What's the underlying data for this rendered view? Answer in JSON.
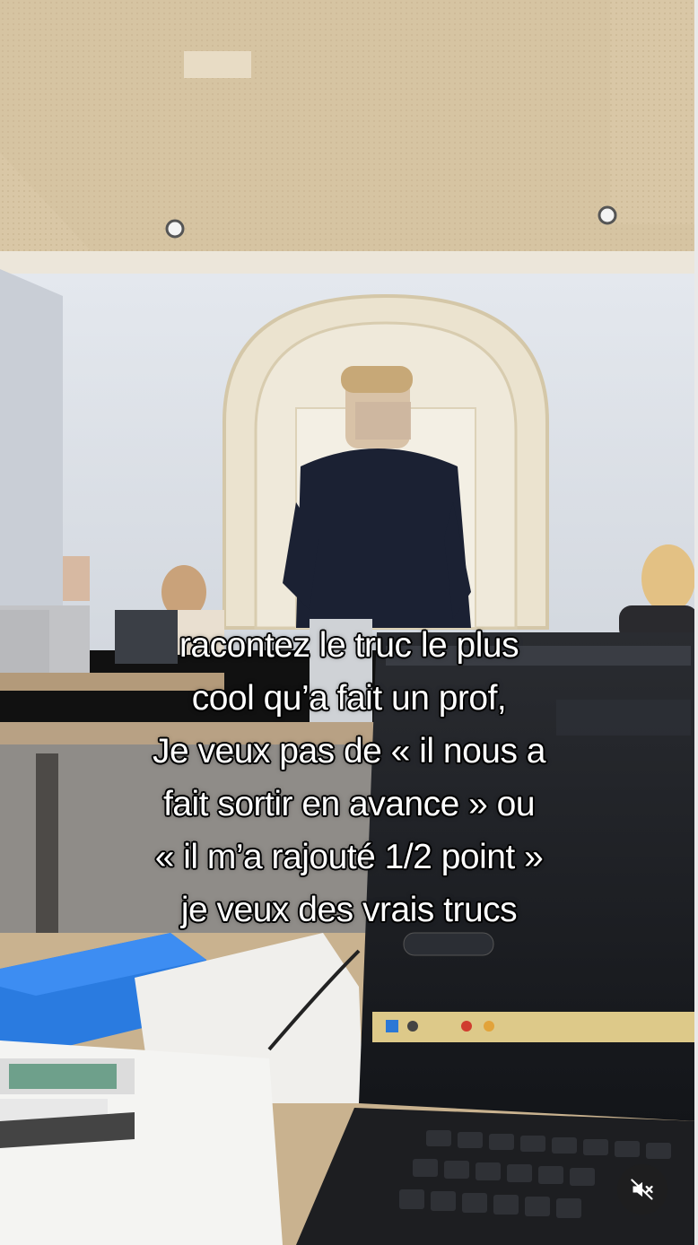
{
  "caption": {
    "lines": [
      "racontez le truc le plus",
      "cool qu’a fait un prof,",
      "Je veux pas de « il nous a",
      "fait sortir en avance » ou",
      "« il m’a rajouté 1/2 point »",
      "je veux des vrais trucs"
    ]
  },
  "controls": {
    "mute_icon": "speaker-muted-icon"
  },
  "colors": {
    "caption_text": "#ffffff",
    "caption_outline": "#000000",
    "mute_button_bg": "#1e1e1e"
  }
}
